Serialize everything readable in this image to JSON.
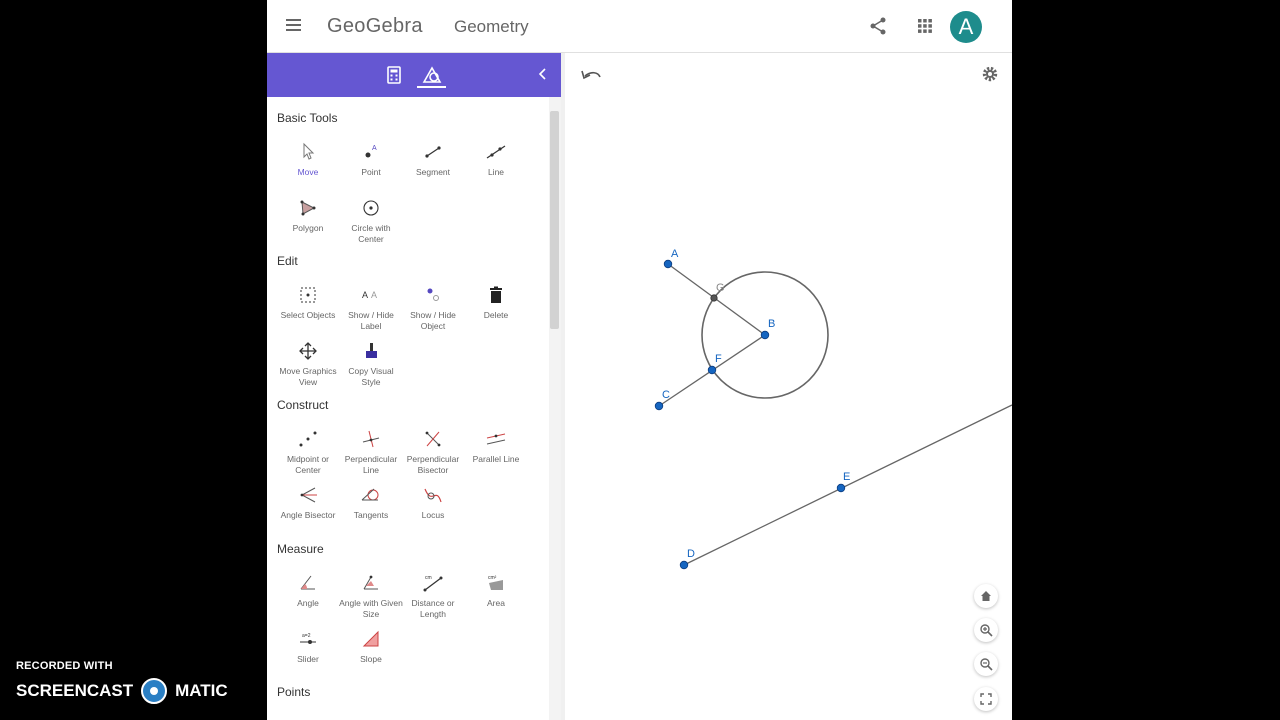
{
  "header": {
    "logo": "GeoGebra",
    "app_name": "Geometry",
    "avatar_letter": "A",
    "icons": [
      "menu-icon",
      "share-icon",
      "apps-grid-icon"
    ]
  },
  "toolbar": {
    "tabs": [
      "calculator-icon",
      "tools-icon"
    ],
    "active_tab": "tools-icon",
    "collapse_icon": "chevron-left-icon"
  },
  "tools": {
    "basic": {
      "title": "Basic Tools",
      "items": [
        {
          "label": "Move",
          "icon": "move-cursor-icon",
          "selected": true
        },
        {
          "label": "Point",
          "icon": "point-icon"
        },
        {
          "label": "Segment",
          "icon": "segment-icon"
        },
        {
          "label": "Line",
          "icon": "line-icon"
        },
        {
          "label": "Polygon",
          "icon": "polygon-icon"
        },
        {
          "label": "Circle with Center",
          "icon": "circle-center-icon"
        }
      ]
    },
    "edit": {
      "title": "Edit",
      "items": [
        {
          "label": "Select Objects",
          "icon": "select-objects-icon"
        },
        {
          "label": "Show / Hide Label",
          "icon": "show-hide-label-icon"
        },
        {
          "label": "Show / Hide Object",
          "icon": "show-hide-object-icon"
        },
        {
          "label": "Delete",
          "icon": "trash-icon"
        },
        {
          "label": "Move Graphics View",
          "icon": "move-graphics-icon"
        },
        {
          "label": "Copy Visual Style",
          "icon": "copy-style-icon"
        }
      ]
    },
    "construct": {
      "title": "Construct",
      "items": [
        {
          "label": "Midpoint or Center",
          "icon": "midpoint-icon"
        },
        {
          "label": "Perpendicular Line",
          "icon": "perpendicular-line-icon"
        },
        {
          "label": "Perpendicular Bisector",
          "icon": "perpendicular-bisector-icon"
        },
        {
          "label": "Parallel Line",
          "icon": "parallel-line-icon"
        },
        {
          "label": "Angle Bisector",
          "icon": "angle-bisector-icon"
        },
        {
          "label": "Tangents",
          "icon": "tangents-icon"
        },
        {
          "label": "Locus",
          "icon": "locus-icon"
        }
      ]
    },
    "measure": {
      "title": "Measure",
      "items": [
        {
          "label": "Angle",
          "icon": "angle-icon"
        },
        {
          "label": "Angle with Given Size",
          "icon": "angle-given-size-icon"
        },
        {
          "label": "Distance or Length",
          "icon": "distance-icon"
        },
        {
          "label": "Area",
          "icon": "area-icon"
        },
        {
          "label": "Slider",
          "icon": "slider-icon"
        },
        {
          "label": "Slope",
          "icon": "slope-icon"
        }
      ]
    },
    "points": {
      "title": "Points"
    }
  },
  "graphics": {
    "points": [
      {
        "name": "A",
        "color": "#1565c0"
      },
      {
        "name": "B",
        "color": "#1565c0"
      },
      {
        "name": "C",
        "color": "#1565c0"
      },
      {
        "name": "D",
        "color": "#1565c0"
      },
      {
        "name": "E",
        "color": "#1565c0"
      },
      {
        "name": "F",
        "color": "#1565c0"
      },
      {
        "name": "G",
        "color": "#555555"
      }
    ],
    "buttons": [
      "undo-icon",
      "settings-icon",
      "home-icon",
      "zoom-in-icon",
      "zoom-out-icon",
      "fullscreen-icon"
    ]
  },
  "watermark": {
    "line1": "RECORDED WITH",
    "brand_left": "SCREENCAST",
    "brand_right": "MATIC"
  },
  "colors": {
    "accent": "#6557d2",
    "point": "#1565c0",
    "avatar": "#1e8c8c"
  }
}
